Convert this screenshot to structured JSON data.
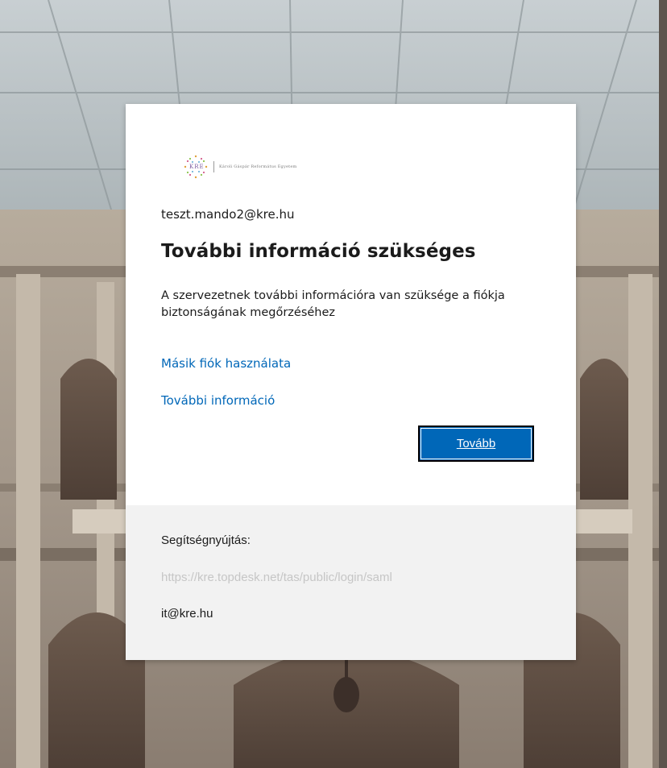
{
  "colors": {
    "accent": "#0067b8",
    "text": "#1b1b1b",
    "footer_background": "#f2f2f2",
    "muted_link": "#c6c6c6"
  },
  "brand": {
    "abbreviation": "KRE",
    "name": "Károli Gáspár Református Egyetem"
  },
  "signin": {
    "identity": "teszt.mando2@kre.hu",
    "title": "További információ szükséges",
    "description": "A szervezetnek további információra van szüksége a fiókja biztonságának megőrzéséhez",
    "other_account_link": "Másik fiók használata",
    "more_info_link": "További információ",
    "next_button": "Tovább"
  },
  "footer": {
    "help_label": "Segítségnyújtás:",
    "help_url": "https://kre.topdesk.net/tas/public/login/saml",
    "help_email": "it@kre.hu"
  }
}
